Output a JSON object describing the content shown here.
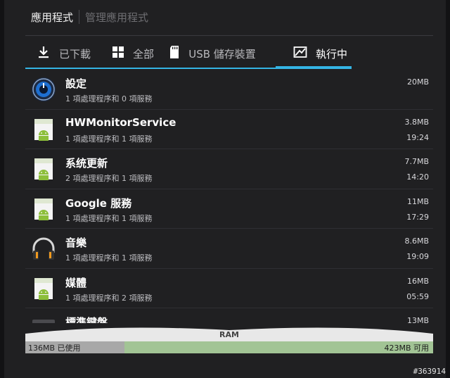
{
  "header": {
    "title": "應用程式",
    "manage_label": "管理應用程式"
  },
  "tabs": [
    {
      "label": "已下載",
      "icon": "download-icon",
      "active": false
    },
    {
      "label": "全部",
      "icon": "grid-icon",
      "active": false
    },
    {
      "label": "USB 儲存裝置",
      "icon": "sd-card-icon",
      "active": false
    },
    {
      "label": "執行中",
      "icon": "running-apps-icon",
      "active": true
    }
  ],
  "apps": [
    {
      "name": "設定",
      "subtitle": "1 項處理程序和 0 項服務",
      "size": "20MB",
      "time": "",
      "icon": "settings-icon"
    },
    {
      "name": "HWMonitorService",
      "subtitle": "1 項處理程序和 1 項服務",
      "size": "3.8MB",
      "time": "19:24",
      "icon": "android-app-icon"
    },
    {
      "name": "系统更新",
      "subtitle": "2 項處理程序和 1 項服務",
      "size": "7.7MB",
      "time": "14:20",
      "icon": "android-app-icon"
    },
    {
      "name": "Google 服務",
      "subtitle": "1 項處理程序和 1 項服務",
      "size": "11MB",
      "time": "17:29",
      "icon": "android-app-icon"
    },
    {
      "name": "音樂",
      "subtitle": "1 項處理程序和 1 項服務",
      "size": "8.6MB",
      "time": "19:09",
      "icon": "headphones-icon"
    },
    {
      "name": "媒體",
      "subtitle": "1 項處理程序和 2 項服務",
      "size": "16MB",
      "time": "05:59",
      "icon": "android-app-icon"
    },
    {
      "name": "標準鍵盤",
      "subtitle": "",
      "size": "13MB",
      "time": "",
      "icon": "keyboard-icon"
    }
  ],
  "ram": {
    "label": "RAM",
    "used_text": "136MB 已使用",
    "free_text": "423MB 可用",
    "used_fraction": 0.243
  },
  "watermark": "#363914",
  "colors": {
    "accent": "#34b5e5",
    "ram_used": "#a8a8a8",
    "ram_free": "#a2c495"
  }
}
